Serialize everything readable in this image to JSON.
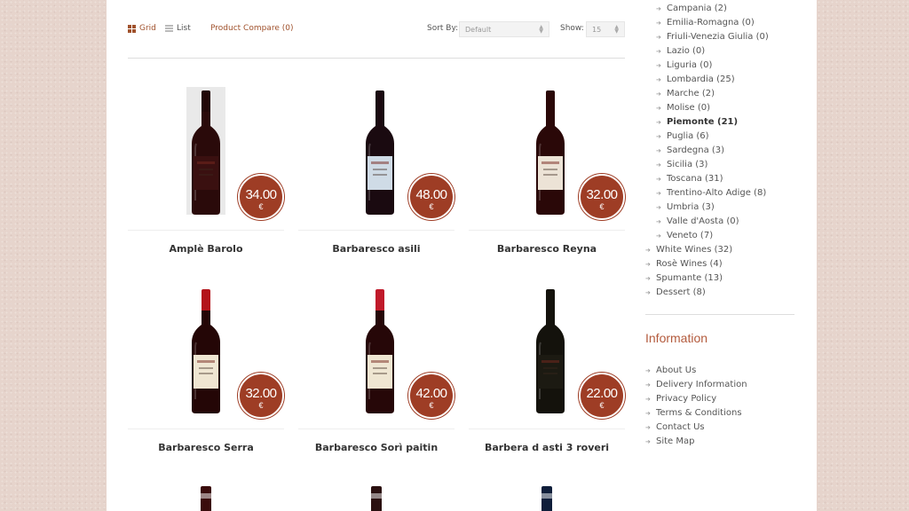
{
  "toolbar": {
    "grid_label": "Grid",
    "list_label": "List",
    "compare_label": "Product Compare (0)",
    "sort_label": "Sort By:",
    "sort_value": "Default",
    "show_label": "Show:",
    "show_value": "15"
  },
  "products": [
    {
      "name": "Amplè Barolo",
      "price": "34.00",
      "currency": "€",
      "bottle_color": "#2a0a0a",
      "label_color": "#3a1010",
      "capsule": "#220808"
    },
    {
      "name": "Barbaresco asili",
      "price": "48.00",
      "currency": "€",
      "bottle_color": "#1a0a10",
      "label_color": "#cfdbe6",
      "capsule": "#1a0a10"
    },
    {
      "name": "Barbaresco Reyna",
      "price": "32.00",
      "currency": "€",
      "bottle_color": "#2a0808",
      "label_color": "#ece3d6",
      "capsule": "#2a0808"
    },
    {
      "name": "Barbaresco Serra",
      "price": "32.00",
      "currency": "€",
      "bottle_color": "#240606",
      "label_color": "#efe6d2",
      "capsule": "#b3141a"
    },
    {
      "name": "Barbaresco Sorì paitin",
      "price": "42.00",
      "currency": "€",
      "bottle_color": "#260708",
      "label_color": "#efe6d2",
      "capsule": "#c01a2a"
    },
    {
      "name": "Barbera d asti 3 roveri",
      "price": "22.00",
      "currency": "€",
      "bottle_color": "#14120c",
      "label_color": "#1c1a12",
      "capsule": "#14120c"
    }
  ],
  "categories": [
    {
      "label": "Campania (2)",
      "sub": true
    },
    {
      "label": "Emilia-Romagna (0)",
      "sub": true
    },
    {
      "label": "Friuli-Venezia Giulia (0)",
      "sub": true
    },
    {
      "label": "Lazio (0)",
      "sub": true
    },
    {
      "label": "Liguria (0)",
      "sub": true
    },
    {
      "label": "Lombardia (25)",
      "sub": true
    },
    {
      "label": "Marche (2)",
      "sub": true
    },
    {
      "label": "Molise (0)",
      "sub": true
    },
    {
      "label": "Piemonte (21)",
      "sub": true,
      "active": true
    },
    {
      "label": "Puglia (6)",
      "sub": true
    },
    {
      "label": "Sardegna (3)",
      "sub": true
    },
    {
      "label": "Sicilia (3)",
      "sub": true
    },
    {
      "label": "Toscana (31)",
      "sub": true
    },
    {
      "label": "Trentino-Alto Adige (8)",
      "sub": true
    },
    {
      "label": "Umbria (3)",
      "sub": true
    },
    {
      "label": "Valle d'Aosta (0)",
      "sub": true
    },
    {
      "label": "Veneto (7)",
      "sub": true
    },
    {
      "label": "White Wines (32)",
      "sub": false
    },
    {
      "label": "Rosè Wines (4)",
      "sub": false
    },
    {
      "label": "Spumante (13)",
      "sub": false
    },
    {
      "label": "Dessert (8)",
      "sub": false
    }
  ],
  "information": {
    "title": "Information",
    "links": [
      "About Us",
      "Delivery Information",
      "Privacy Policy",
      "Terms & Conditions",
      "Contact Us",
      "Site Map"
    ]
  },
  "colors": {
    "accent": "#a0522d",
    "price_badge": "#9e3d25",
    "page_bg": "#e6d4cc"
  }
}
